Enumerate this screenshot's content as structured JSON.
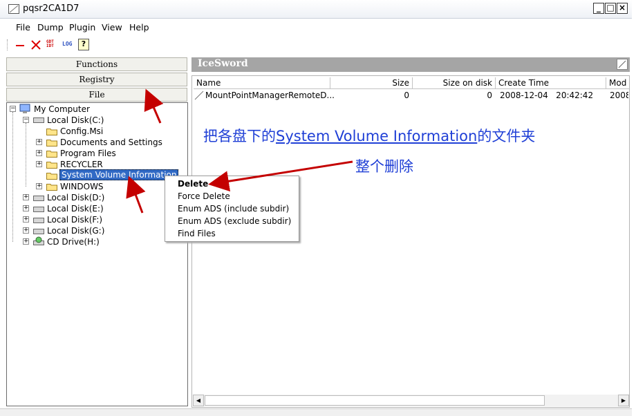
{
  "window": {
    "title": "pqsr2CA1D7",
    "min_label": "_",
    "max_label": "□",
    "close_label": "×"
  },
  "menu": {
    "items": [
      "File",
      "Dump",
      "Plugin",
      "View",
      "Help"
    ]
  },
  "toolbar": {
    "gdt_label_top": "GDT",
    "gdt_label_bottom": "IDT",
    "log_label": "LOG",
    "help_label": "?"
  },
  "left_tabs": {
    "functions": "Functions",
    "registry": "Registry",
    "file": "File"
  },
  "tree": {
    "root": "My Computer",
    "disk_c": "Local Disk(C:)",
    "c_children": [
      "Config.Msi",
      "Documents and Settings",
      "Program Files",
      "RECYCLER",
      "System Volume Information",
      "WINDOWS"
    ],
    "disk_d": "Local Disk(D:)",
    "disk_e": "Local Disk(E:)",
    "disk_f": "Local Disk(F:)",
    "disk_g": "Local Disk(G:)",
    "cd_drive": "CD Drive(H:)"
  },
  "right_panel": {
    "title": "IceSword",
    "columns": [
      "Name",
      "Size",
      "Size on disk",
      "Create Time",
      "Mod"
    ],
    "rows": [
      {
        "name": "MountPointManagerRemoteD...",
        "size": "0",
        "size_on_disk": "0",
        "create_time": "2008-12-04   20:42:42",
        "mod": "2008"
      }
    ]
  },
  "context_menu": {
    "items": [
      "Delete",
      "Force Delete",
      "Enum ADS (include subdir)",
      "Enum ADS (exclude subdir)",
      "Find Files"
    ]
  },
  "annotation": {
    "prefix": "把各盘下的",
    "link": "System Volume Information",
    "suffix": "的文件夹",
    "line2": "整个删除"
  },
  "colors": {
    "selection": "#316ac5",
    "annotation_text": "#1f3fd6",
    "arrow": "#c40000",
    "header_gray": "#a5a5a5"
  }
}
